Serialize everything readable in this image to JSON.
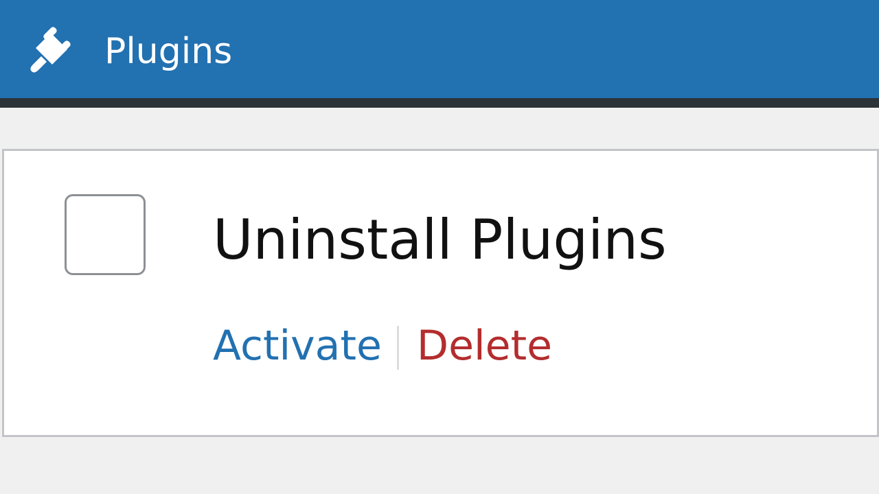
{
  "header": {
    "title": "Plugins",
    "icon": "plug-icon",
    "background": "#2271b1"
  },
  "plugin": {
    "name": "Uninstall Plugins",
    "checked": false,
    "actions": {
      "activate": "Activate",
      "delete": "Delete"
    }
  },
  "colors": {
    "link": "#2271b1",
    "delete": "#b32d2e"
  }
}
